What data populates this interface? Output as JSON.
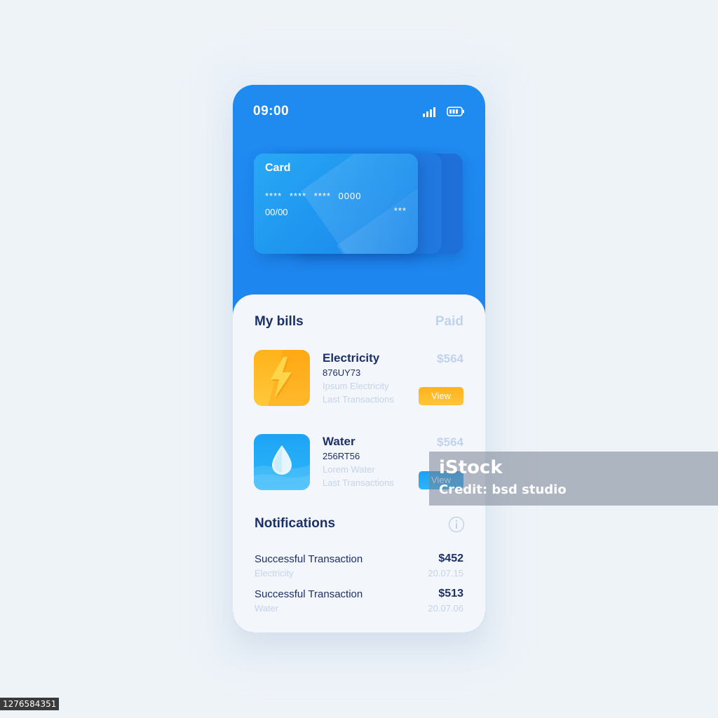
{
  "status": {
    "time": "09:00"
  },
  "card": {
    "title": "Card",
    "number": "**** **** **** 0000",
    "expiry": "00/00",
    "cvv": "***"
  },
  "bills": {
    "title": "My bills",
    "paid_label": "Paid",
    "items": [
      {
        "name": "Electricity",
        "code": "876UY73",
        "desc1": "Ipsum Electricity",
        "desc2": "Last Transactions",
        "amount": "$564",
        "button": "View",
        "icon": "lightning-icon"
      },
      {
        "name": "Water",
        "code": "256RT56",
        "desc1": "Lorem Water",
        "desc2": "Last Transactions",
        "amount": "$564",
        "button": "View",
        "icon": "water-drop-icon"
      }
    ]
  },
  "notifications": {
    "title": "Notifications",
    "items": [
      {
        "name": "Successful Transaction",
        "sub": "Electricity",
        "amount": "$452",
        "date": "20.07.15"
      },
      {
        "name": "Successful Transaction",
        "sub": "Water",
        "amount": "$513",
        "date": "20.07.06"
      }
    ]
  },
  "watermark": {
    "brand": "iStock",
    "credit": "Credit: bsd studio",
    "id": "1276584351"
  },
  "colors": {
    "primary": "#1f8bf0",
    "navy": "#1c2f66",
    "muted": "#c4d3e8",
    "amber": "#ffb21b"
  }
}
